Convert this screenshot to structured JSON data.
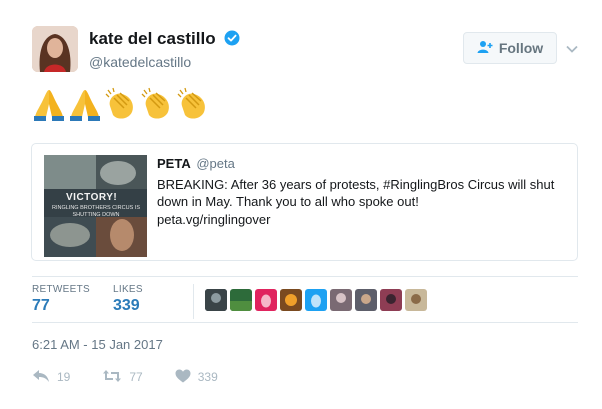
{
  "author": {
    "name": "kate del castillo",
    "handle": "@katedelcastillo",
    "verified": true
  },
  "follow_button": {
    "label": "Follow"
  },
  "tweet": {
    "emojis": [
      "folded-hands",
      "folded-hands",
      "clapping-hands",
      "clapping-hands",
      "clapping-hands"
    ]
  },
  "quoted": {
    "name": "PETA",
    "handle": "@peta",
    "text": "BREAKING: After 36 years of protests, #RinglingBros Circus will shut down in May. Thank you to all who spoke out!",
    "link": "peta.vg/ringlingover",
    "thumbnail_text_1": "VICTORY!",
    "thumbnail_text_2": "RINGLING BROTHERS CIRCUS IS SHUTTING DOWN"
  },
  "stats": {
    "retweets_label": "RETWEETS",
    "retweets_value": "77",
    "likes_label": "LIKES",
    "likes_value": "339"
  },
  "timestamp": "6:21 AM - 15 Jan 2017",
  "actions": {
    "reply_count": "19",
    "retweet_count": "77",
    "like_count": "339"
  },
  "colors": {
    "verified": "#1da1f2",
    "stat_value": "#2b7bb9",
    "muted": "#657786",
    "border": "#e1e8ed"
  }
}
